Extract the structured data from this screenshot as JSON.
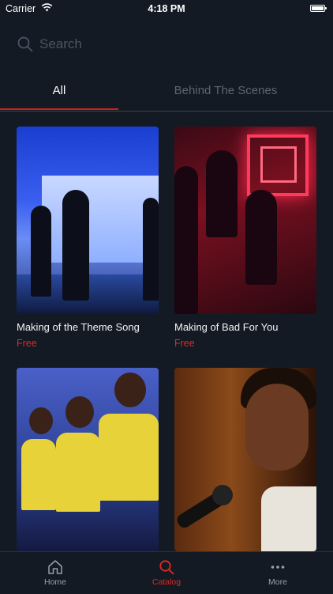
{
  "status_bar": {
    "carrier": "Carrier",
    "time": "4:18 PM"
  },
  "search": {
    "placeholder": "Search"
  },
  "tabs": [
    {
      "label": "All",
      "selected": true
    },
    {
      "label": "Behind The Scenes",
      "selected": false
    }
  ],
  "cards": [
    {
      "title": "Making of the Theme Song",
      "price": "Free"
    },
    {
      "title": "Making of Bad For You",
      "price": "Free"
    },
    {
      "title": "",
      "price": ""
    },
    {
      "title": "",
      "price": ""
    }
  ],
  "tab_bar": {
    "items": [
      {
        "label": "Home",
        "icon": "home-icon",
        "selected": false
      },
      {
        "label": "Catalog",
        "icon": "search-icon",
        "selected": true
      },
      {
        "label": "More",
        "icon": "more-dots-icon",
        "selected": false
      }
    ]
  },
  "colors": {
    "background": "#131a24",
    "accent": "#e02a20",
    "inactive_tab": "#5c6470"
  }
}
